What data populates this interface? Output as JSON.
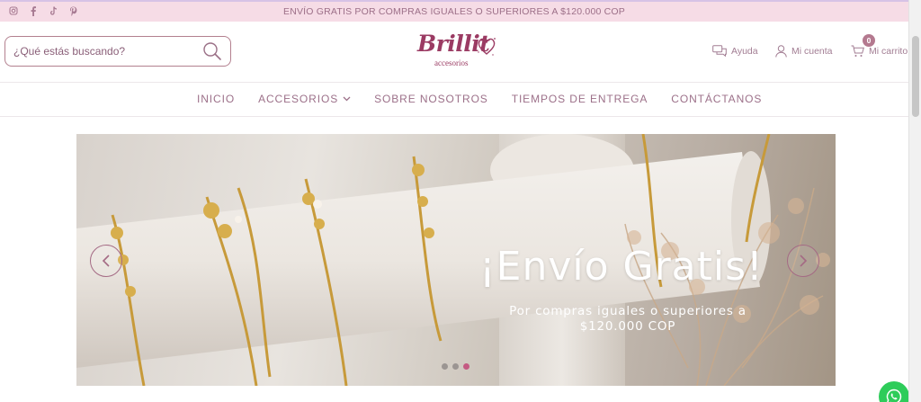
{
  "topbar": {
    "promo_text": "ENVÍO GRATIS POR COMPRAS IGUALES O SUPERIORES A $120.000 COP",
    "social_icons": [
      "instagram-icon",
      "facebook-icon",
      "tiktok-icon",
      "pinterest-icon"
    ]
  },
  "header": {
    "search": {
      "placeholder": "¿Qué estás buscando?",
      "value": ""
    },
    "logo": {
      "script": "Brillit",
      "subtitle": "accesorios"
    },
    "help_label": "Ayuda",
    "account_label": "Mi cuenta",
    "cart_label": "Mi carrito",
    "cart_count": "0"
  },
  "nav": {
    "items": [
      {
        "label": "INICIO"
      },
      {
        "label": "ACCESORIOS"
      },
      {
        "label": "SOBRE NOSOTROS"
      },
      {
        "label": "TIEMPOS DE ENTREGA"
      },
      {
        "label": "CONTÁCTANOS"
      }
    ]
  },
  "banner": {
    "title": "¡Envío Gratis!",
    "subtitle": "Por compras iguales o superiores a $120.000 COP",
    "slides": 3,
    "active_slide": 3
  },
  "colors": {
    "brand": "#9b3b63",
    "topbar_bg": "#f6dce6",
    "text": "#8a5f78",
    "whatsapp": "#2ecc5a"
  }
}
